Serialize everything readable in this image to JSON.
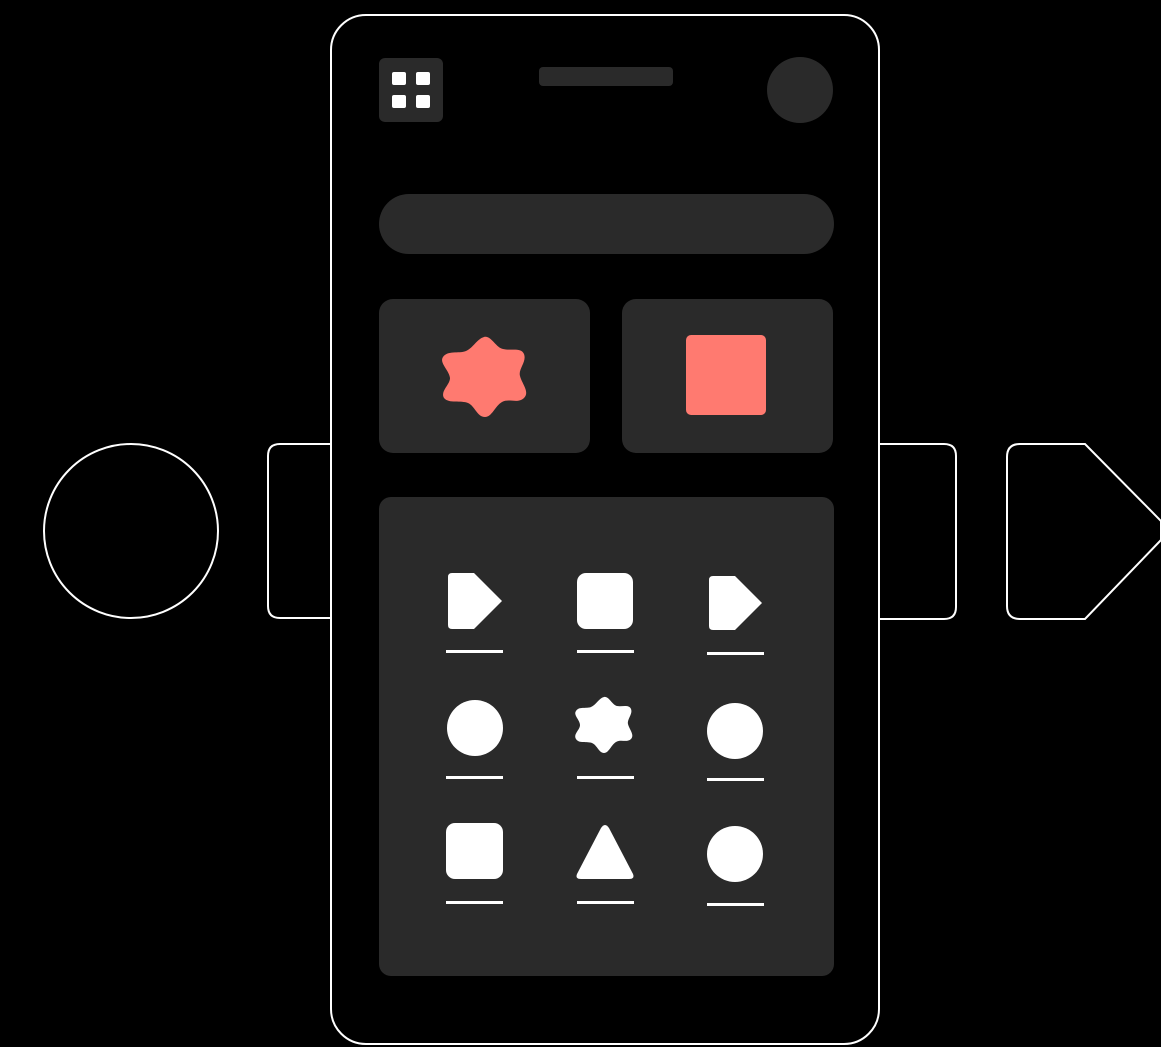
{
  "colors": {
    "background": "#000000",
    "outline": "#ffffff",
    "surface": "#2a2a2a",
    "accent": "#ff7a70",
    "icon": "#ffffff"
  },
  "header": {
    "menu_icon": "grid-icon",
    "avatar": "avatar-placeholder"
  },
  "cards": [
    {
      "icon": "blob-icon",
      "color": "accent"
    },
    {
      "icon": "square-icon",
      "color": "accent"
    }
  ],
  "grid_items": [
    {
      "icon": "pentagon-tag-icon"
    },
    {
      "icon": "rounded-square-icon"
    },
    {
      "icon": "pentagon-tag-icon"
    },
    {
      "icon": "circle-icon"
    },
    {
      "icon": "blob-icon"
    },
    {
      "icon": "circle-icon"
    },
    {
      "icon": "rounded-square-icon"
    },
    {
      "icon": "triangle-icon"
    },
    {
      "icon": "circle-icon"
    }
  ],
  "background_shapes": [
    "circle-outline",
    "rounded-rect-outline",
    "rounded-rect-outline",
    "tag-outline"
  ]
}
